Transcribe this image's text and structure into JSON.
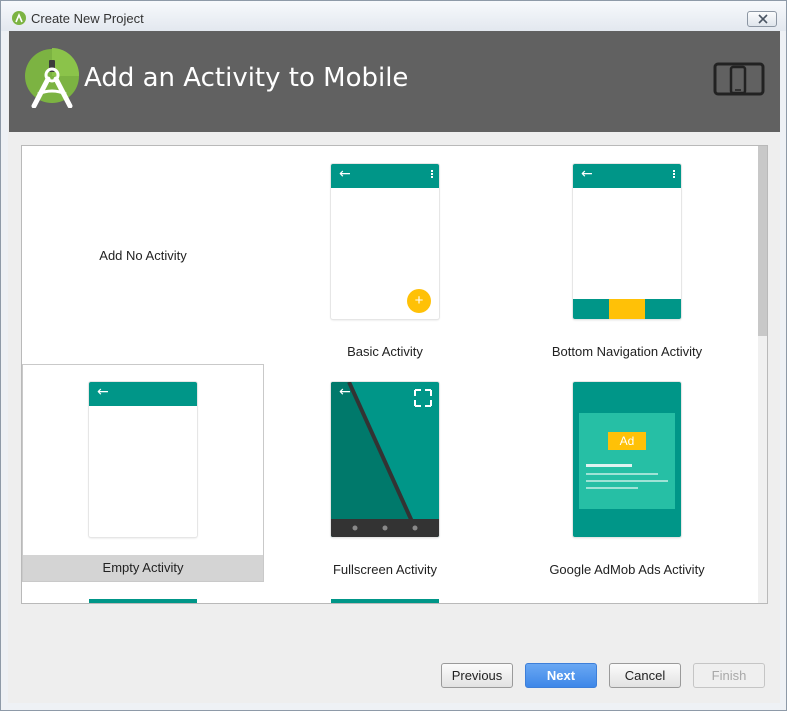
{
  "window": {
    "title": "Create New Project",
    "close_glyph": "✕"
  },
  "banner": {
    "title": "Add an Activity to Mobile",
    "logo_icon": "android-studio-logo-icon",
    "device_icon": "phone-tablet-icon",
    "bg_color": "#616161"
  },
  "templates": [
    {
      "label": "Add No Activity",
      "selected": false
    },
    {
      "label": "Basic Activity",
      "selected": false
    },
    {
      "label": "Bottom Navigation Activity",
      "selected": false
    },
    {
      "label": "Empty Activity",
      "selected": true
    },
    {
      "label": "Fullscreen Activity",
      "selected": false
    },
    {
      "label": "Google AdMob Ads Activity",
      "selected": false
    }
  ],
  "thumbs": {
    "back_arrow": "←",
    "fab_plus": "+",
    "ad_badge": "Ad"
  },
  "buttons": {
    "previous": "Previous",
    "next": "Next",
    "cancel": "Cancel",
    "finish": "Finish"
  },
  "colors": {
    "teal": "#009688",
    "amber": "#ffc107",
    "selected_bg": "#d4d4d4",
    "primary_button": "#3d87e8"
  }
}
